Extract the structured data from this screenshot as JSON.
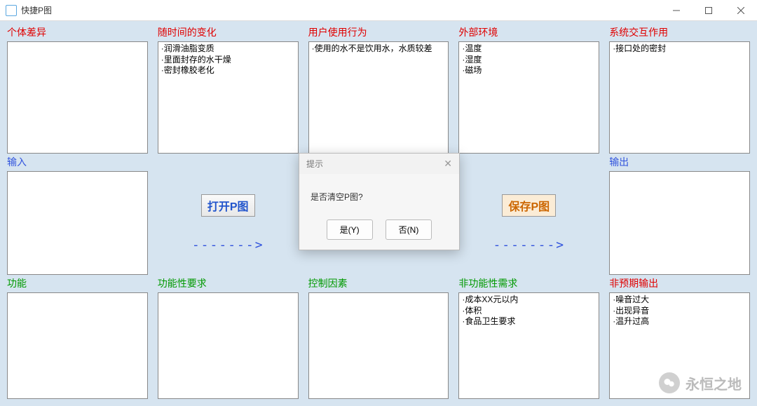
{
  "window": {
    "title": "快捷P图"
  },
  "rows": {
    "top": [
      {
        "header": "个体差异",
        "headerColor": "red",
        "content": ""
      },
      {
        "header": "随时间的变化",
        "headerColor": "red",
        "content": "·润滑油脂变质\n·里面封存的水干燥\n·密封橡胶老化"
      },
      {
        "header": "用户使用行为",
        "headerColor": "red",
        "content": "·使用的水不是饮用水，水质较差"
      },
      {
        "header": "外部环境",
        "headerColor": "red",
        "content": "·温度\n·湿度\n·磁场"
      },
      {
        "header": "系统交互作用",
        "headerColor": "red",
        "content": "·接口处的密封"
      }
    ],
    "mid": {
      "leftHeader": "输入",
      "rightHeader": "输出",
      "leftContent": "",
      "rightContent": "",
      "openLabel": "打开P图",
      "saveLabel": "保存P图",
      "arrow": "------->"
    },
    "bottom": [
      {
        "header": "功能",
        "headerColor": "green",
        "content": ""
      },
      {
        "header": "功能性要求",
        "headerColor": "green",
        "content": ""
      },
      {
        "header": "控制因素",
        "headerColor": "green",
        "content": ""
      },
      {
        "header": "非功能性需求",
        "headerColor": "green",
        "content": "·成本XX元以内\n·体积\n·食品卫生要求"
      },
      {
        "header": "非预期输出",
        "headerColor": "red",
        "content": "·噪音过大\n·出现异音\n·温升过高"
      }
    ]
  },
  "dialog": {
    "title": "提示",
    "message": "是否清空P图?",
    "yes": "是(Y)",
    "no": "否(N)"
  },
  "watermark": {
    "text": "永恒之地"
  }
}
